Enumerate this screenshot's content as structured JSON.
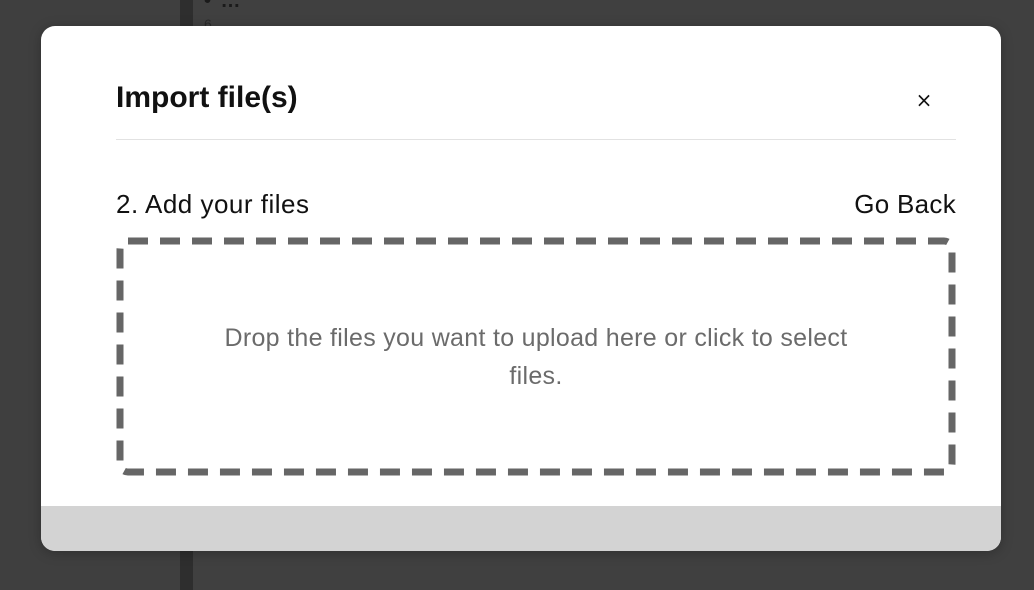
{
  "background": {
    "snippet": "• …",
    "snippet2": "6"
  },
  "modal": {
    "title": "Import file(s)",
    "close_label": "×",
    "step_title": "2. Add your files",
    "go_back_label": "Go Back",
    "dropzone_text": "Drop the files you want to upload here or click to select files."
  },
  "colors": {
    "overlay": "#404040",
    "modal_bg": "#ffffff",
    "dropzone_border": "#666666",
    "dropzone_text": "#6b6b6b",
    "footer_bg": "#d3d3d3"
  },
  "icons": {
    "close": "close-icon"
  }
}
